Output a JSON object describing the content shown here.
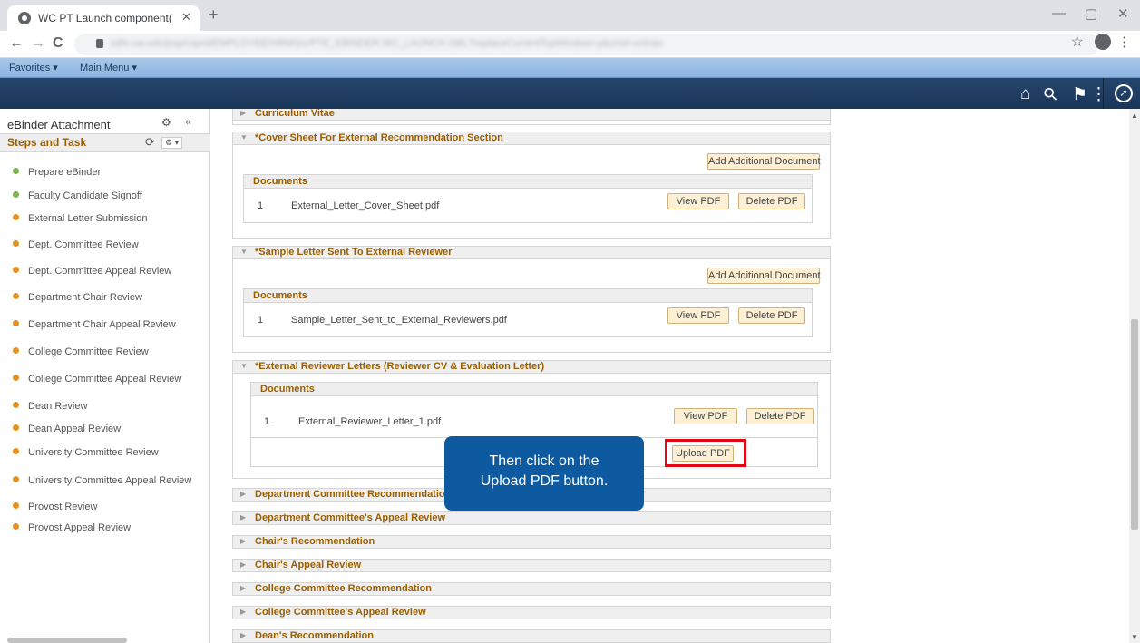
{
  "browser": {
    "tab_title": "WC PT Launch component(Hidden",
    "tab_close": "✕",
    "new_tab": "+",
    "url": "sdhr.uw.edu/psp/csprd/EMPLOYEE/HRMS/c/PTE_EBINDER.WC_LAUNCH.GBL?replaceCurrentTopWindow=y&cmd=uninav",
    "win_minimize": "—",
    "win_restore": "▢",
    "win_close": "✕",
    "back": "←",
    "forward": "→",
    "reload": "C",
    "star": "☆",
    "menu": "⋮"
  },
  "favorites_bar": {
    "favorites": "Favorites ▾",
    "main_menu": "Main Menu ▾"
  },
  "navbar_icons": [
    "home-icon",
    "search-icon",
    "flag-icon",
    "actions-menu-icon",
    "navbar-compass-icon"
  ],
  "navbar_glyphs": {
    "home": "⌂",
    "search": "⚲",
    "flag": "⚑",
    "actions": "⋮",
    "compass": "➚"
  },
  "sidebar": {
    "title": "eBinder Attachment",
    "gear": "⚙",
    "collapse": "«",
    "steps_title": "Steps and Task",
    "refresh": "⟳",
    "options": "⚙ ▾",
    "steps": [
      {
        "label": "Prepare eBinder",
        "status": "complete"
      },
      {
        "label": "Faculty Candidate Signoff",
        "status": "complete"
      },
      {
        "label": "External Letter Submission",
        "status": "pending"
      },
      {
        "label": "Dept. Committee Review",
        "status": "pending"
      },
      {
        "label": "Dept. Committee Appeal Review",
        "status": "pending"
      },
      {
        "label": "Department Chair Review",
        "status": "pending"
      },
      {
        "label": "Department Chair Appeal Review",
        "status": "pending"
      },
      {
        "label": "College Committee Review",
        "status": "pending"
      },
      {
        "label": "College Committee Appeal Review",
        "status": "pending"
      },
      {
        "label": "Dean Review",
        "status": "pending"
      },
      {
        "label": "Dean Appeal Review",
        "status": "pending"
      },
      {
        "label": "University Committee Review",
        "status": "pending"
      },
      {
        "label": "University Committee Appeal Review",
        "status": "pending"
      },
      {
        "label": "Provost Review",
        "status": "pending"
      },
      {
        "label": "Provost Appeal Review",
        "status": "pending"
      }
    ]
  },
  "colors": {
    "complete": "#7ab648",
    "pending": "#e8921b",
    "section_label": "#9b5f00",
    "navbar": "#1a3558",
    "callout": "#0e5aa0",
    "highlight": "#e30613"
  },
  "sections": {
    "curriculum_vitae": "Curriculum Vitae",
    "cover_sheet": {
      "title": "*Cover Sheet For External Recommendation Section",
      "add_button": "Add Additional Document",
      "documents_header": "Documents",
      "row_num": "1",
      "file": "External_Letter_Cover_Sheet.pdf",
      "view": "View PDF",
      "delete": "Delete PDF"
    },
    "sample_letter": {
      "title": "*Sample Letter Sent To External Reviewer",
      "add_button": "Add Additional Document",
      "documents_header": "Documents",
      "row_num": "1",
      "file": "Sample_Letter_Sent_to_External_Reviewers.pdf",
      "view": "View PDF",
      "delete": "Delete PDF"
    },
    "external_letters": {
      "title": "*External Reviewer Letters (Reviewer CV & Evaluation Letter)",
      "documents_header": "Documents",
      "row_num": "1",
      "file": "External_Reviewer_Letter_1.pdf",
      "view": "View PDF",
      "delete": "Delete PDF",
      "upload": "Upload PDF"
    },
    "collapsed": [
      "Department Committee Recommendation",
      "Department Committee's Appeal Review",
      "Chair's Recommendation",
      "Chair's Appeal Review",
      "College Committee Recommendation",
      "College Committee's Appeal Review",
      "Dean's Recommendation"
    ]
  },
  "callout": {
    "line1": "Then click on the",
    "line2": "Upload PDF button."
  }
}
